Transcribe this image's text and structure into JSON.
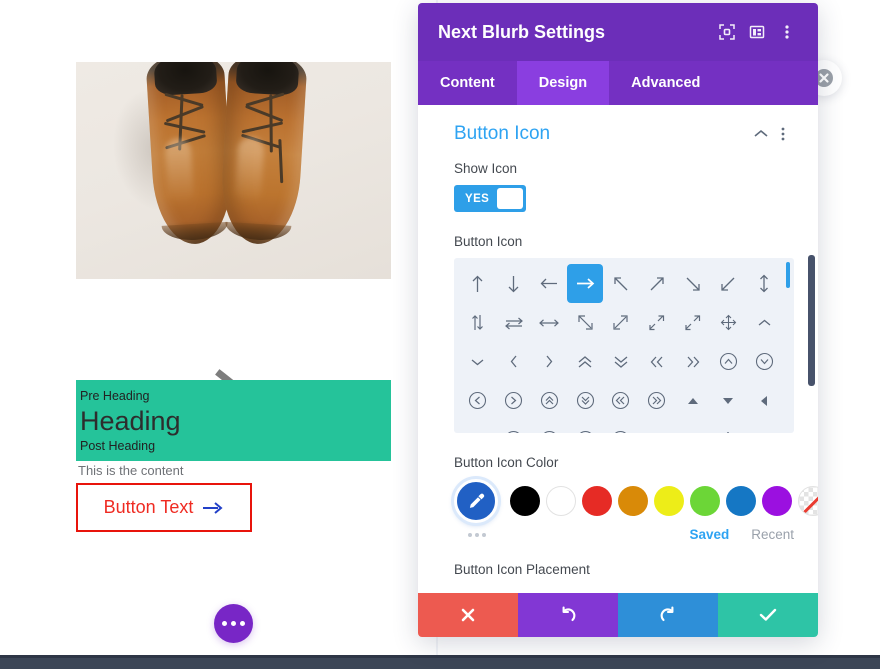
{
  "preview": {
    "image_alt": "brown leather boots photo",
    "arrow_icon": "arrow-right-icon",
    "pre_heading": "Pre Heading",
    "heading": "Heading",
    "post_heading": "Post Heading",
    "content": "This is the content",
    "button_label": "Button Text",
    "button_icon": "arrow-right-icon",
    "fab_icon": "ellipsis-icon",
    "heading_bg_color": "#25c39a",
    "button_border_color": "#e8140c",
    "button_text_color": "#ef2b22"
  },
  "panel": {
    "title": "Next Blurb Settings",
    "header_icons": [
      "focus-target-icon",
      "layout-panel-icon",
      "kebab-menu-icon"
    ],
    "close_icon": "close-circle-icon",
    "tabs": [
      {
        "label": "Content",
        "active": false
      },
      {
        "label": "Design",
        "active": true
      },
      {
        "label": "Advanced",
        "active": false
      }
    ],
    "section": {
      "title": "Button Icon",
      "collapse_icon": "chevron-up-icon",
      "menu_icon": "kebab-menu-icon"
    },
    "show_icon": {
      "label": "Show Icon",
      "value": "YES"
    },
    "button_icon": {
      "label": "Button Icon",
      "selected_index": 3,
      "icons": [
        "↑",
        "↓",
        "←",
        "→",
        "↖",
        "↗",
        "↘",
        "↙",
        "↕",
        "↕",
        "⇌",
        "↔",
        "⤡",
        "⤢",
        "⤡",
        "⤢",
        "✥",
        "⌃",
        "⌄",
        "‹",
        "›",
        "⌃⌃",
        "⌄⌄",
        "«",
        "»",
        "⌃○",
        "⌄○",
        "‹○",
        "›○",
        "⌃◎",
        "⌄◎",
        "«◎",
        "»◎",
        "▲",
        "▼",
        "◀",
        "▶",
        "▲◎",
        "▼◎",
        "◀◎",
        "▶◎",
        "↩",
        "−",
        "+",
        "×"
      ]
    },
    "button_icon_color": {
      "label": "Button Icon Color",
      "picker_icon": "eyedropper-icon",
      "more_icon": "ellipsis-icon",
      "swatches": [
        "#000000",
        "#ffffff",
        "#e62b25",
        "#d98a08",
        "#eded18",
        "#6cd637",
        "#1577c4",
        "#9b10e0",
        "transparent"
      ],
      "saved_label": "Saved",
      "recent_label": "Recent"
    },
    "button_icon_placement": {
      "label": "Button Icon Placement"
    },
    "actions": [
      {
        "name": "cancel",
        "icon": "close-x-icon",
        "color": "#ed5a50"
      },
      {
        "name": "undo",
        "icon": "undo-icon",
        "color": "#8237d4"
      },
      {
        "name": "redo",
        "icon": "redo-icon",
        "color": "#2e8fd8"
      },
      {
        "name": "save",
        "icon": "check-icon",
        "color": "#2ec4a6"
      }
    ]
  }
}
